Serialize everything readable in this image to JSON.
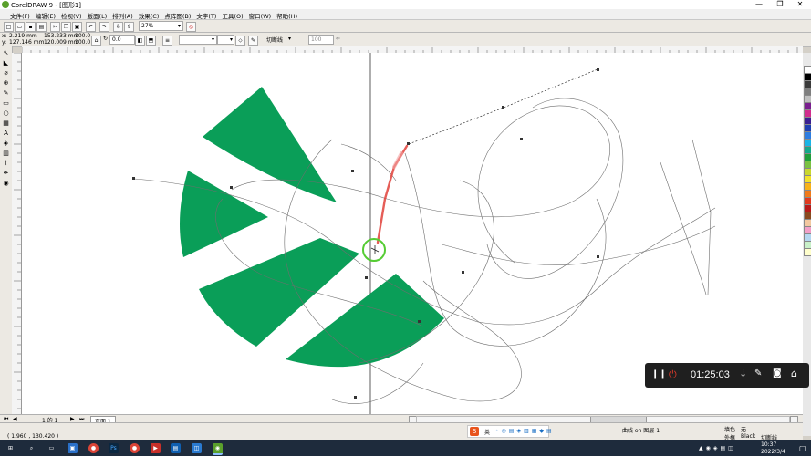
{
  "window": {
    "title": "CorelDRAW 9 - [图形1]",
    "controls": [
      "—",
      "❐",
      "✕"
    ]
  },
  "menu": {
    "items": [
      "文件(F)",
      "编辑(E)",
      "检视(V)",
      "版面(L)",
      "排列(A)",
      "效果(C)",
      "点阵图(B)",
      "文字(T)",
      "工具(O)",
      "窗口(W)",
      "帮助(H)"
    ]
  },
  "toolbar": {
    "zoom_value": "27%"
  },
  "property_bar": {
    "x_label": "x:",
    "x_value": "2.219 mm",
    "y_label": "y:",
    "y_value": "127.146 mm",
    "w_value": "153.233 mm",
    "h_value": "120.009 mm",
    "scale_x": "100.0",
    "scale_y": "100.0",
    "rotation": "0.0",
    "outline_label": "切断线",
    "smooth_value": "100"
  },
  "page_nav": {
    "page_of": "1 的 1",
    "page_tab": "页面 1"
  },
  "status": {
    "coordinates": "( 1.960 , 130.420 )",
    "object_info": "曲线 on 图层 1",
    "fill_label": "填色",
    "fill_value": "无",
    "outline_label": "外框",
    "outline_value": "Black",
    "outline_type": "切断线"
  },
  "recorder": {
    "time": "01:25:03"
  },
  "ime": {
    "label": "英"
  },
  "taskbar": {
    "clock_time": "10:37",
    "clock_date": "2022/3/4"
  },
  "colors": {
    "shape_green": "#0a9e58",
    "stroke_highlight": "#e0413a",
    "cursor_ring": "#55cc33",
    "taskbar_bg": "#1e2b3c"
  },
  "palette": [
    "#ffffff",
    "#000000",
    "#3a3a3a",
    "#7f7f7f",
    "#bfbfbf",
    "#7a1f8f",
    "#d12d8e",
    "#3a1f91",
    "#1f3fb0",
    "#2e7de0",
    "#1ab4e6",
    "#14a88a",
    "#1f9e3a",
    "#7ac142",
    "#c9d72e",
    "#f2e22a",
    "#f7b21a",
    "#f07a1a",
    "#e03a1f",
    "#b81a1a",
    "#8a4a1f",
    "#f2c8a0",
    "#f29fc8",
    "#b4d7f0",
    "#c8f0c8",
    "#ffffcc"
  ]
}
